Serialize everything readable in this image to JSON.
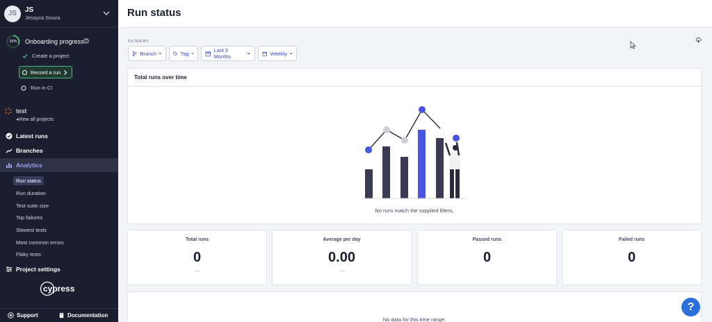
{
  "user": {
    "initials": "JS",
    "name": "Jessyca Souza"
  },
  "onboarding": {
    "percent": "33%",
    "progress": 0.33,
    "title": "Onboarding progress",
    "steps": {
      "create": "Create a project",
      "record": "Record a run",
      "ci": "Run in CI"
    }
  },
  "project": {
    "name": "test",
    "view_all": "View all projects"
  },
  "nav": {
    "latest_runs": "Latest runs",
    "branches": "Branches",
    "analytics": "Analytics",
    "project_settings": "Project settings"
  },
  "analytics_items": [
    "Run status",
    "Run duration",
    "Test suite size",
    "Top failures",
    "Slowest tests",
    "Most common errors",
    "Flaky tests"
  ],
  "footer": {
    "support": "Support",
    "documentation": "Documentation"
  },
  "logo_text": "cypress",
  "page": {
    "title": "Run status"
  },
  "filters": {
    "label": "FILTER BY",
    "branch": "Branch",
    "tag": "Tag",
    "range": "Last 3 Months",
    "interval": "Weekly"
  },
  "chart_panel": {
    "title": "Total runs over time",
    "empty_message": "No runs match the supplied filters."
  },
  "stats": [
    {
      "label": "Total runs",
      "value": "0",
      "sub": "—"
    },
    {
      "label": "Average per day",
      "value": "0.00",
      "sub": "—"
    },
    {
      "label": "Passed runs",
      "value": "0",
      "sub": ""
    },
    {
      "label": "Failed runs",
      "value": "0",
      "sub": ""
    }
  ],
  "bottom_panel": {
    "message": "No data for this time range."
  },
  "help_label": "?",
  "colors": {
    "sidebar": "#1b1e2e",
    "accent": "#4956e3",
    "success": "#4fb581",
    "link": "#3e49b8"
  }
}
